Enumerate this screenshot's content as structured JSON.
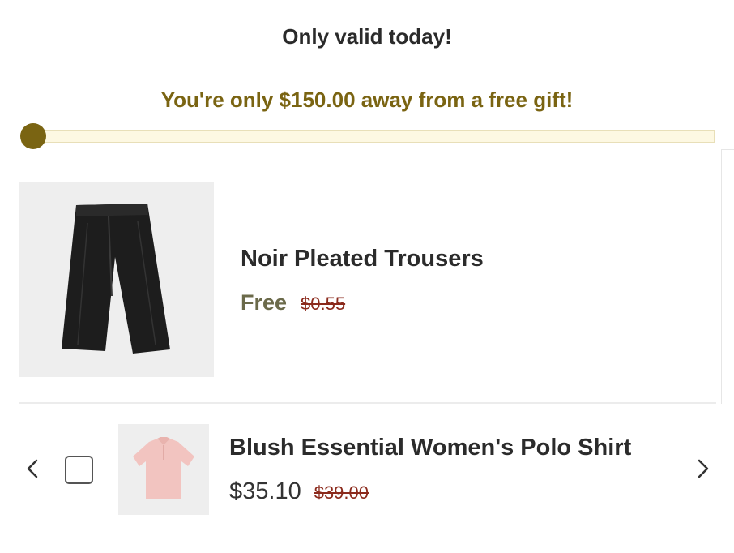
{
  "promo": {
    "title": "Only valid today!"
  },
  "progress": {
    "message": "You're only $150.00 away from a free gift!",
    "fraction": 0.02,
    "color": "#7a6412"
  },
  "gift_item": {
    "name": "Noir Pleated Trousers",
    "price": "Free",
    "compare_price": "$0.55",
    "image_icon": "black-trousers-image"
  },
  "upsell": {
    "prev_icon": "chevron-left-icon",
    "next_icon": "chevron-right-icon",
    "checked": false,
    "name": "Blush Essential Women's Polo Shirt",
    "price": "$35.10",
    "compare_price": "$39.00",
    "image_icon": "pink-polo-shirt-image"
  }
}
